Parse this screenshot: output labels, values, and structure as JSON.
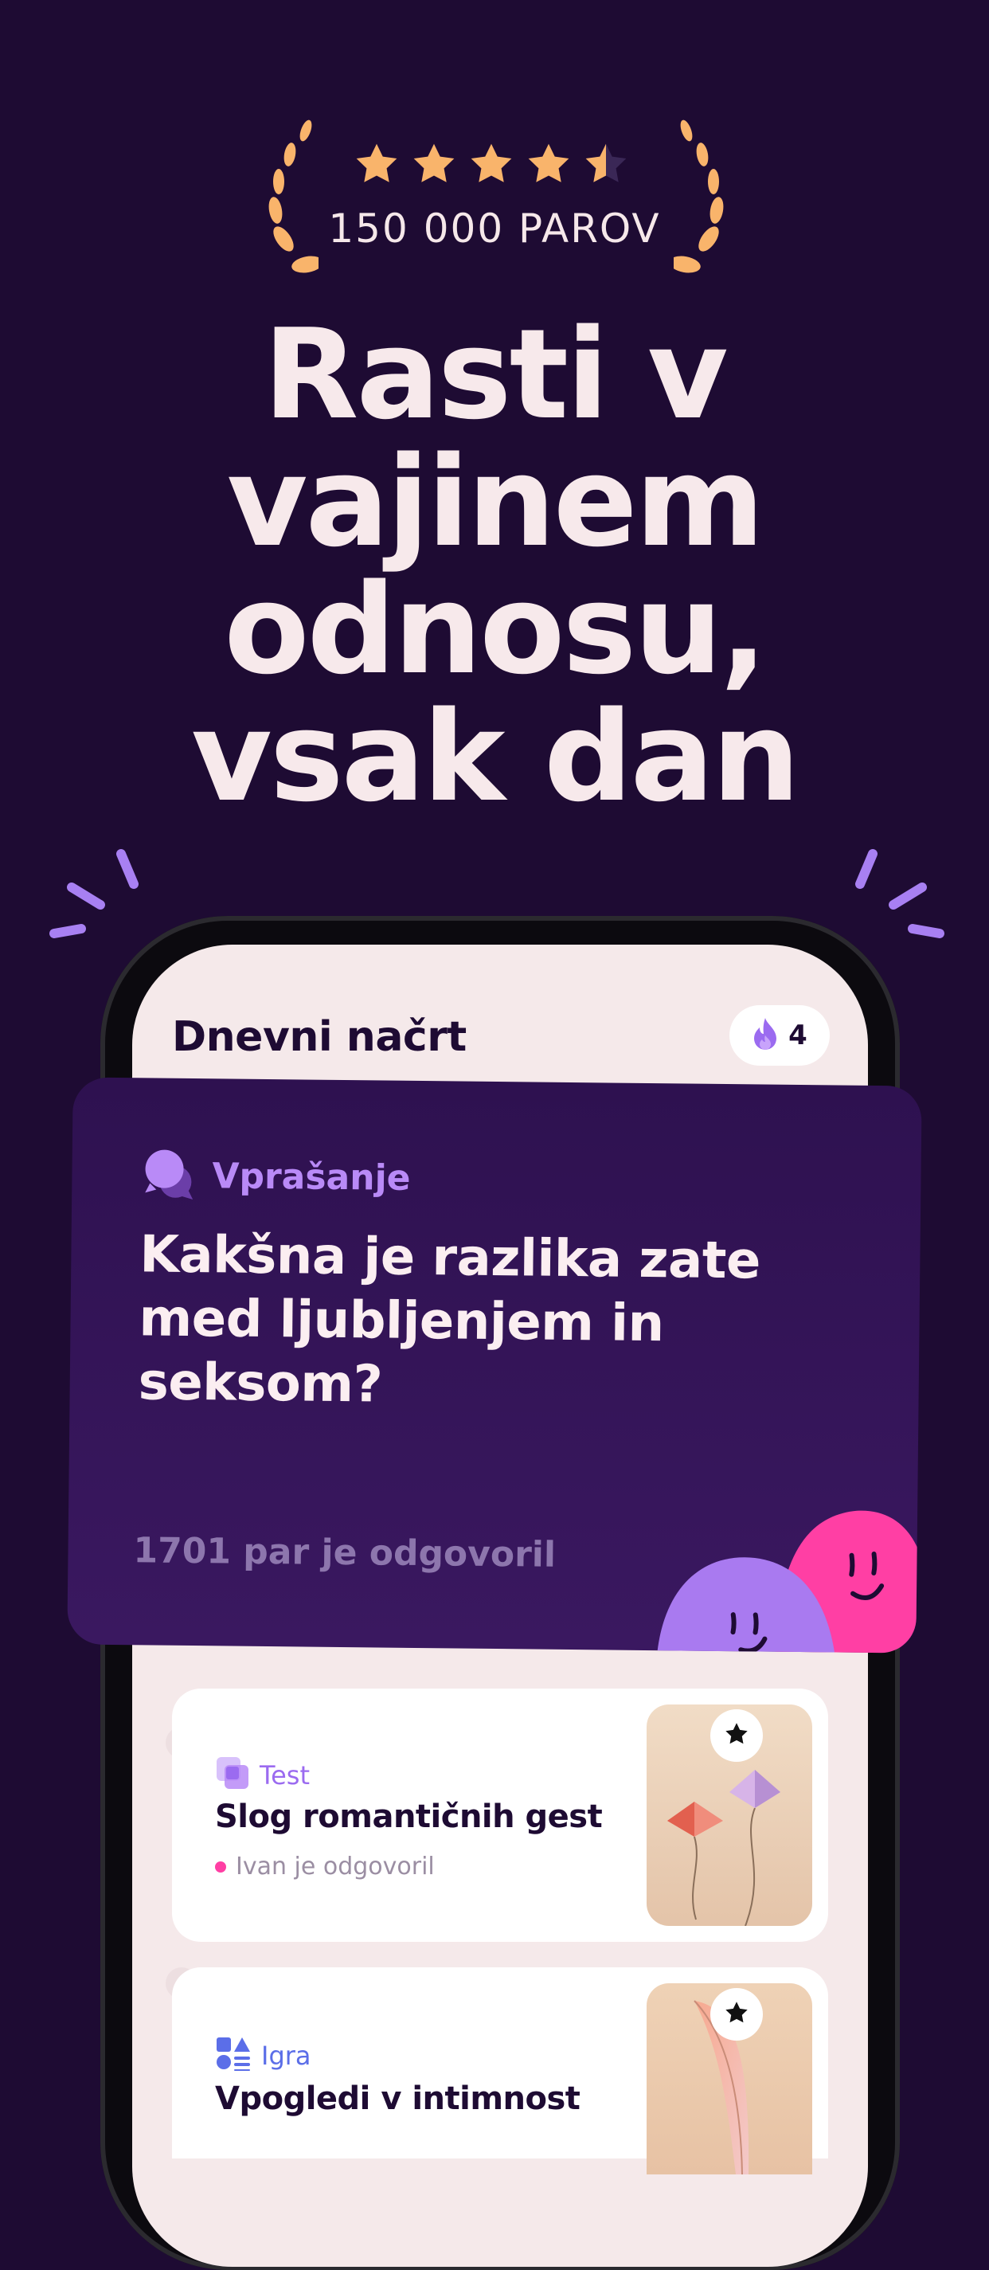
{
  "rating": {
    "stars": 4.5,
    "label": "150 000 PAROV",
    "star_color": "#f9b46b"
  },
  "headline": "Rasti v vajinem odnosu, vsak dan",
  "app": {
    "title": "Dnevni načrt",
    "streak": {
      "count": "4",
      "icon": "flame-icon"
    },
    "question_card": {
      "tag": "Vprašanje",
      "text": "Kakšna je razlika zate med ljubljenjem in seksom?",
      "answered": "1701 par je odgovoril"
    },
    "activities": [
      {
        "tag": "Test",
        "title": "Slog romantičnih gest",
        "status": "Ivan je odgovoril",
        "status_color": "#ff3fa4",
        "icon": "star-icon"
      },
      {
        "tag": "Igra",
        "title": "Vpogledi v intimnost",
        "icon": "star-icon"
      }
    ]
  },
  "colors": {
    "background": "#1e0b33",
    "accent_purple": "#b98af7",
    "accent_pink": "#ff3fa4"
  }
}
